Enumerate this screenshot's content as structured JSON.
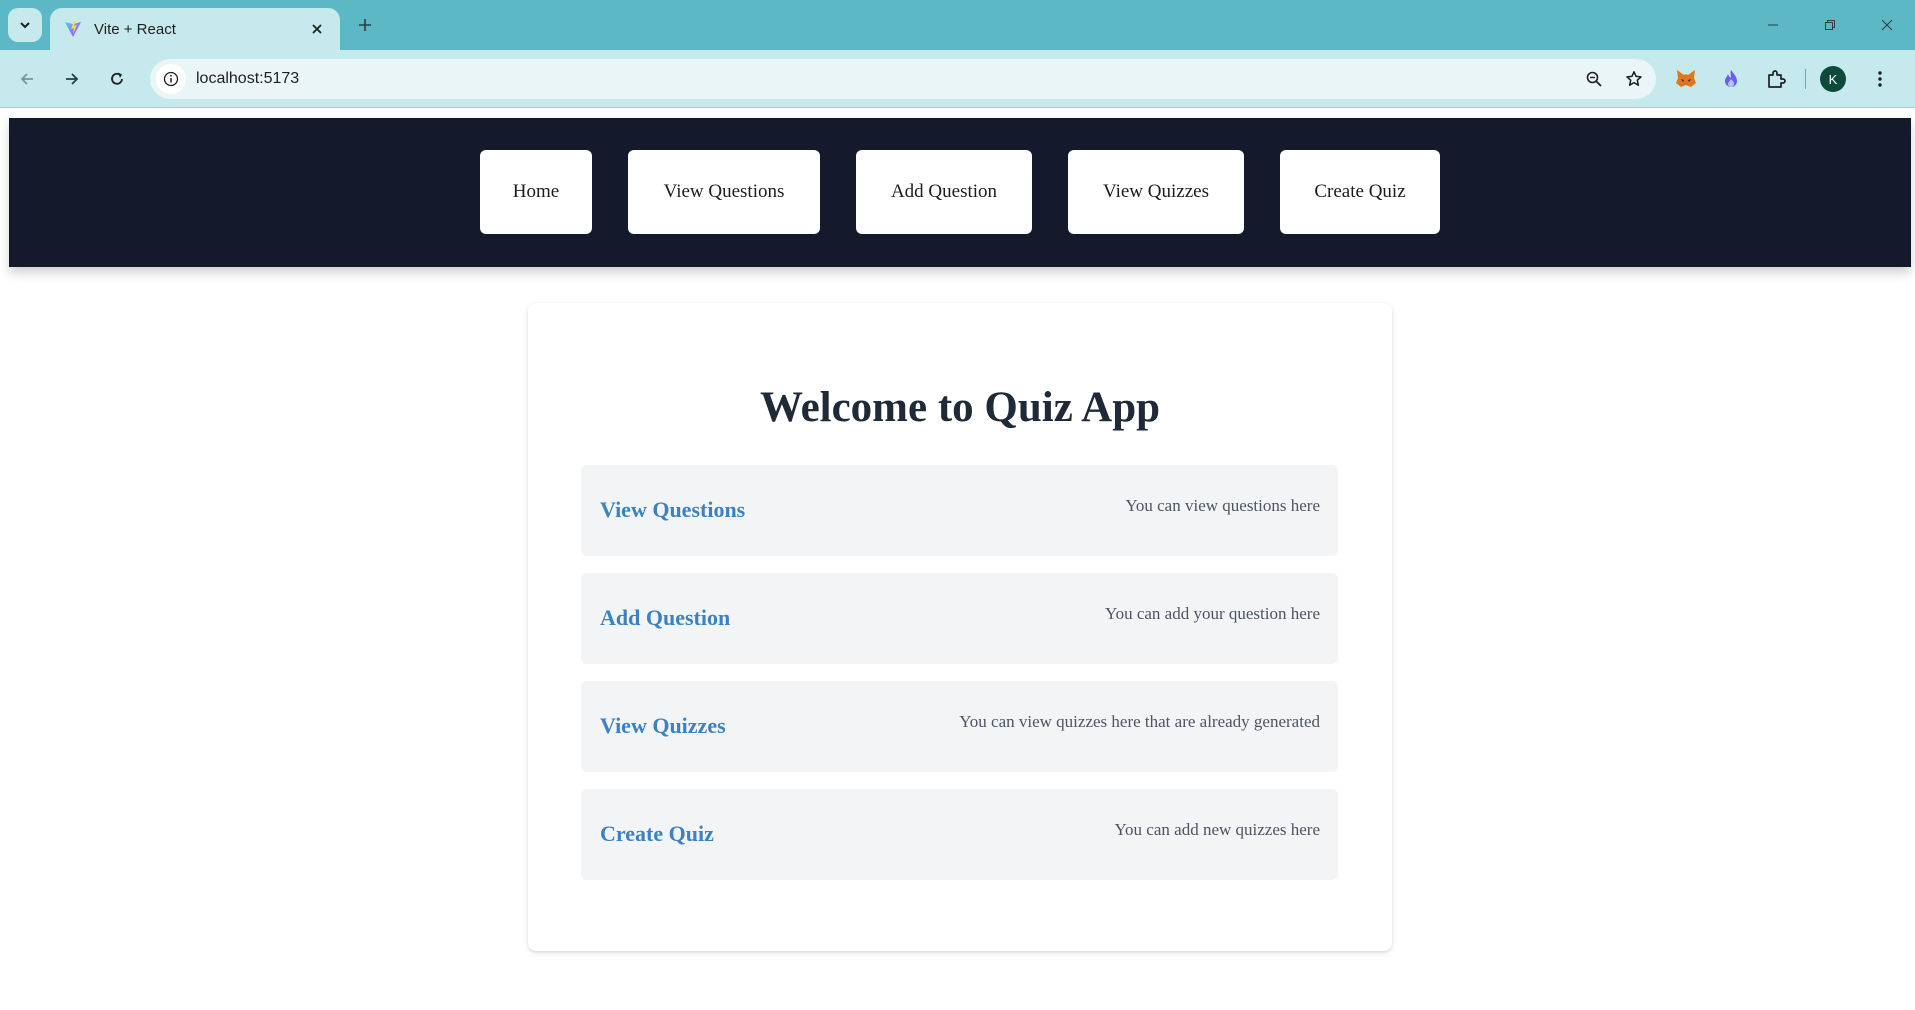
{
  "browser": {
    "tab_title": "Vite + React",
    "url": "localhost:5173",
    "profile_initial": "K"
  },
  "nav": {
    "links": [
      "Home",
      "View Questions",
      "Add Question",
      "View Quizzes",
      "Create Quiz"
    ]
  },
  "main": {
    "heading": "Welcome to Quiz App",
    "features": [
      {
        "title": "View Questions",
        "description": "You can view questions here"
      },
      {
        "title": "Add Question",
        "description": "You can add your question here"
      },
      {
        "title": "View Quizzes",
        "description": "You can view quizzes here that are already generated"
      },
      {
        "title": "Create Quiz",
        "description": "You can add new quizzes here"
      }
    ]
  },
  "colors": {
    "chrome_frame": "#5bb8c4",
    "chrome_toolbar": "#c6e9ee",
    "nav_bg": "#141a2b",
    "link_blue": "#3b82c4",
    "feature_bg": "#f3f4f6"
  }
}
